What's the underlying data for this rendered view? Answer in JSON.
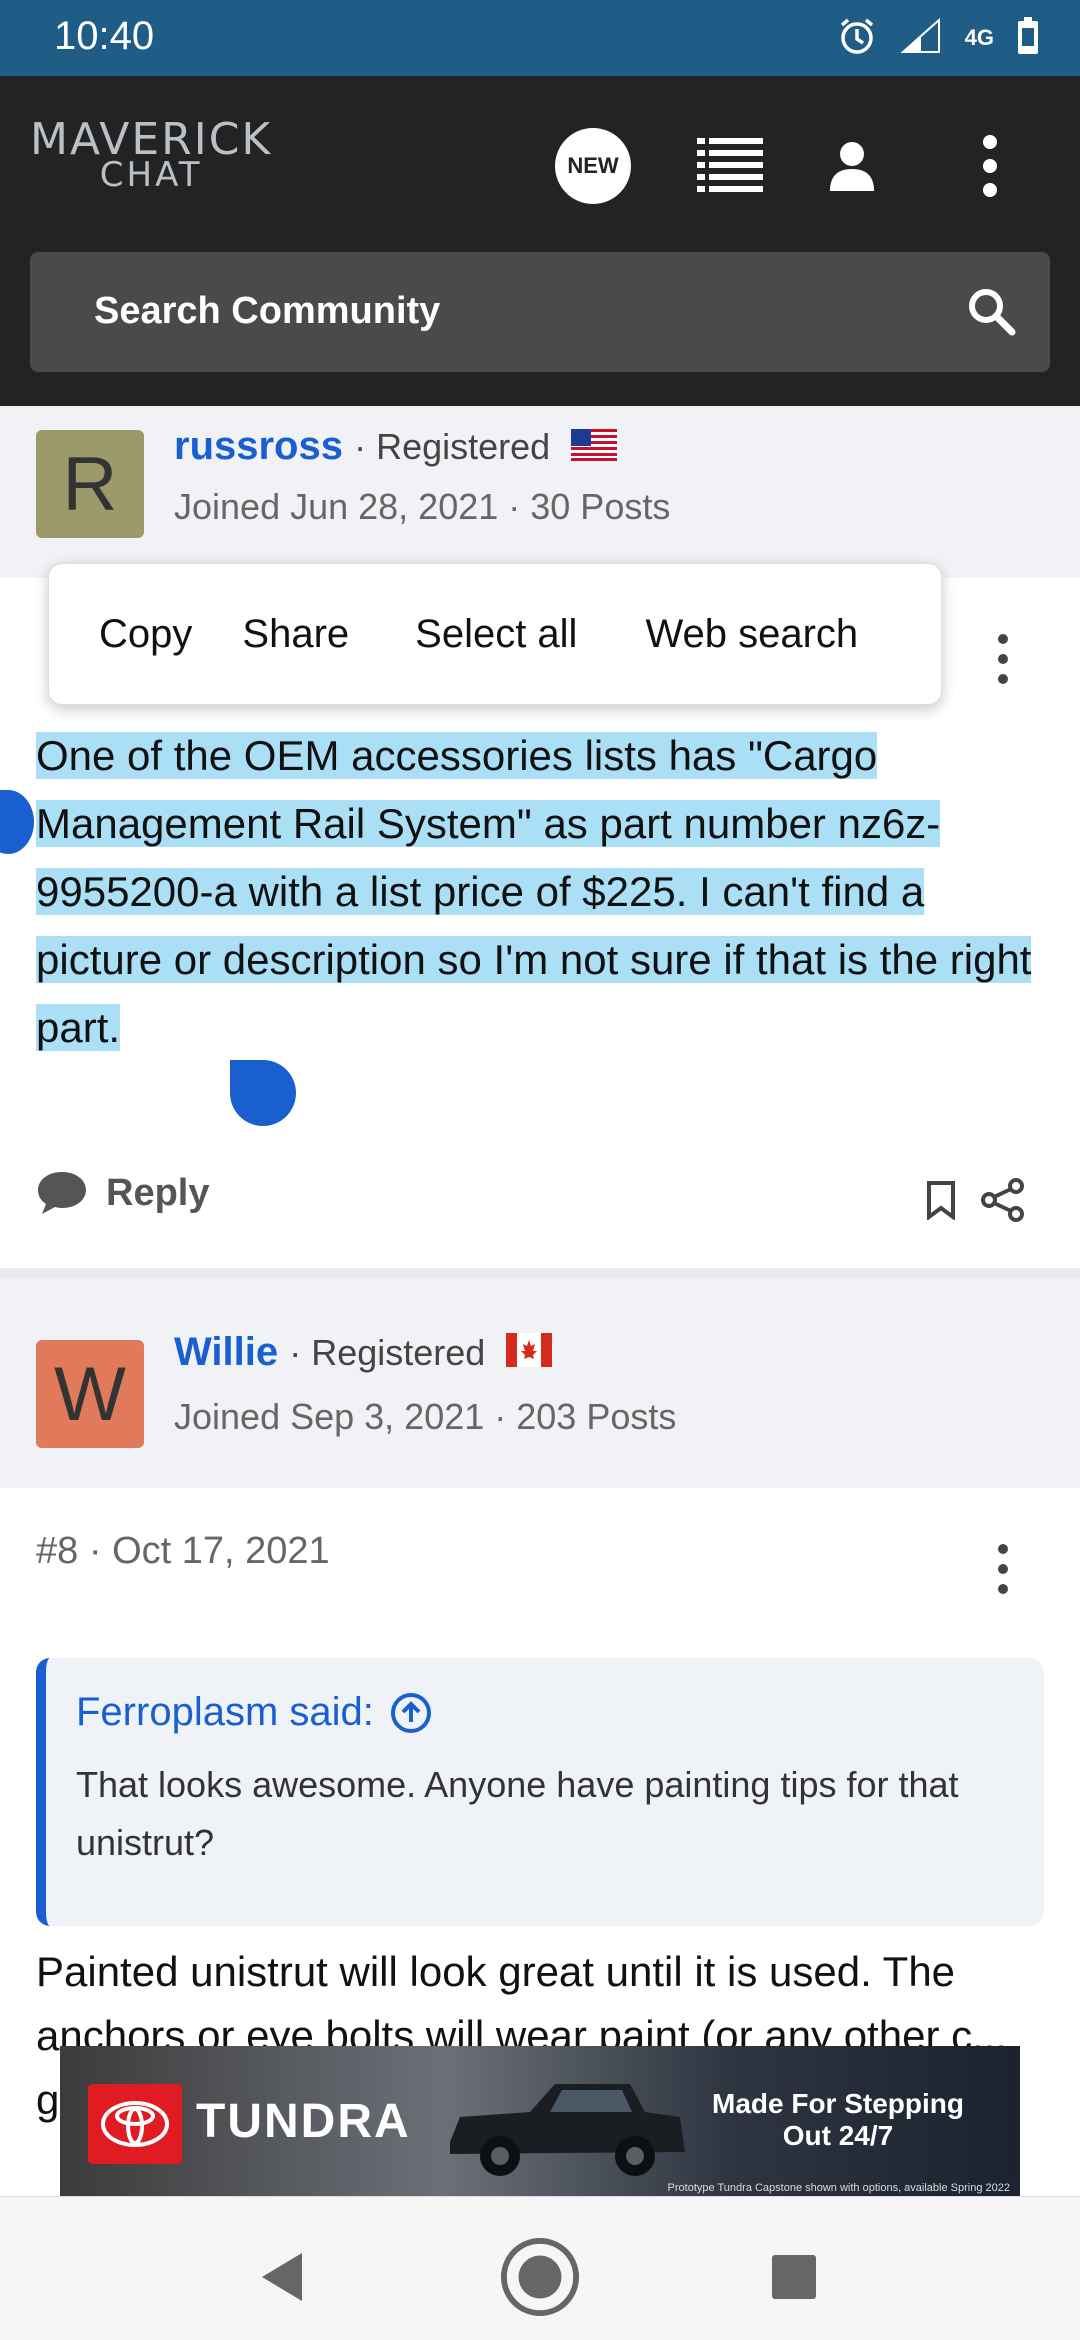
{
  "status_bar": {
    "time": "10:40",
    "network": "4G",
    "icons": [
      "alarm-icon",
      "signal-icon",
      "battery-icon"
    ]
  },
  "header": {
    "logo_line1": "MAVERICK",
    "logo_line2": "CHAT",
    "new_label": "NEW",
    "icons": [
      "new-posts-icon",
      "list-icon",
      "user-icon",
      "more-icon"
    ]
  },
  "search": {
    "placeholder": "Search Community"
  },
  "post1": {
    "avatar_letter": "R",
    "username": "russross",
    "role": "Registered",
    "flag": "US",
    "joined": "Joined Jun 28, 2021",
    "posts": "30 Posts",
    "body": "One of the OEM accessories lists has \"Cargo Management Rail System\" as part number nz6z-9955200-a with a list price of $225. I can't find a picture or description so I'm not sure if that is the right part.",
    "reply_label": "Reply"
  },
  "context_menu": {
    "items": [
      "Copy",
      "Share",
      "Select all",
      "Web search"
    ]
  },
  "post2": {
    "avatar_letter": "W",
    "username": "Willie",
    "role": "Registered",
    "flag": "CA",
    "joined": "Joined Sep 3, 2021",
    "posts": "203 Posts",
    "number": "#8",
    "date": "Oct 17, 2021",
    "quote_author": "Ferroplasm said:",
    "quote_body": "That looks awesome. Anyone have painting tips for that unistrut?",
    "body_partial": "Painted unistrut will look great until it is used. The anchors or eye bolts will wear paint (or any other c... g..."
  },
  "ad": {
    "brand": "TUNDRA",
    "tagline": "Made For Stepping Out 24/7",
    "fine_print": "Prototype Tundra Capstone shown with options, available Spring 2022",
    "colors": {
      "brand_red": "#e01b22"
    }
  },
  "colors": {
    "status_bar": "#1f5c86",
    "header": "#232323",
    "link_blue": "#1a5fd0",
    "selection": "#aadff5"
  }
}
